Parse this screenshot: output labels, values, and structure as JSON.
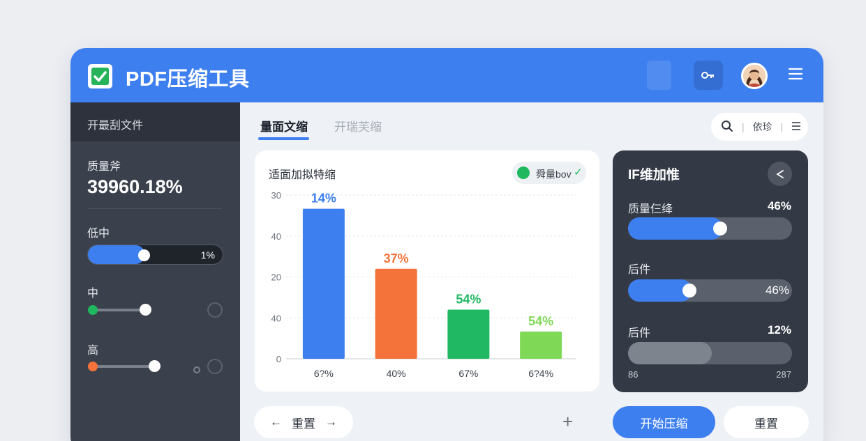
{
  "header": {
    "title": "PDF压缩工具",
    "key_icon": "key-icon",
    "menu_icon": "menu-icon"
  },
  "sidebar": {
    "open_file": "开最刮文件",
    "quality_label": "质量斧",
    "quality_value": "39960.18%",
    "low_label": "低中",
    "low_slider_value": "1%",
    "low_slider_level": 0.42,
    "mid_label": "中",
    "high_label": "高"
  },
  "tabs": [
    {
      "label": "量面文缩"
    },
    {
      "label": "开瑞芙缩"
    }
  ],
  "search": {
    "search_icon": "search-icon",
    "text": "依珍",
    "sep1": "|",
    "sep2": "|",
    "list_icon": "list-icon"
  },
  "chart_card": {
    "title": "适面加拟特缩",
    "legend_text": "舜量bov",
    "legend_check": "✓"
  },
  "chart_data": {
    "type": "bar",
    "categories": [
      "6?%",
      "40%",
      "67%",
      "6?4%"
    ],
    "values": [
      55,
      33,
      18,
      10
    ],
    "bar_labels": [
      "14%",
      "37%",
      "54%",
      "54%"
    ],
    "colors": [
      "#3e7ff0",
      "#f4733a",
      "#20b862",
      "#7fd856"
    ],
    "y_ticks": [
      "0",
      "40",
      "20",
      "40",
      "30"
    ],
    "ylim": [
      0,
      60
    ],
    "grid": true
  },
  "settings_card": {
    "title": "IF维加惟",
    "share_icon": "share-icon",
    "rows": [
      {
        "label": "质量仨绛",
        "value": "46%",
        "level": 0.58,
        "inner_value": ""
      },
      {
        "label": "后件",
        "value": "",
        "level": 0.39,
        "inner_value": "46%"
      },
      {
        "label": "后件",
        "value": "12%",
        "level": 0.51,
        "inner_value": ""
      }
    ],
    "min_label": "86",
    "max_label": "287"
  },
  "footer": {
    "reset_nav_label": "重置",
    "left_arrow": "←",
    "right_arrow": "→",
    "plus": "+",
    "start_label": "开始压缩",
    "reset_label": "重置"
  },
  "colors": {
    "accent": "#3e7ff0",
    "sidebar_bg": "#3a404c",
    "card_dark": "#343a45"
  }
}
